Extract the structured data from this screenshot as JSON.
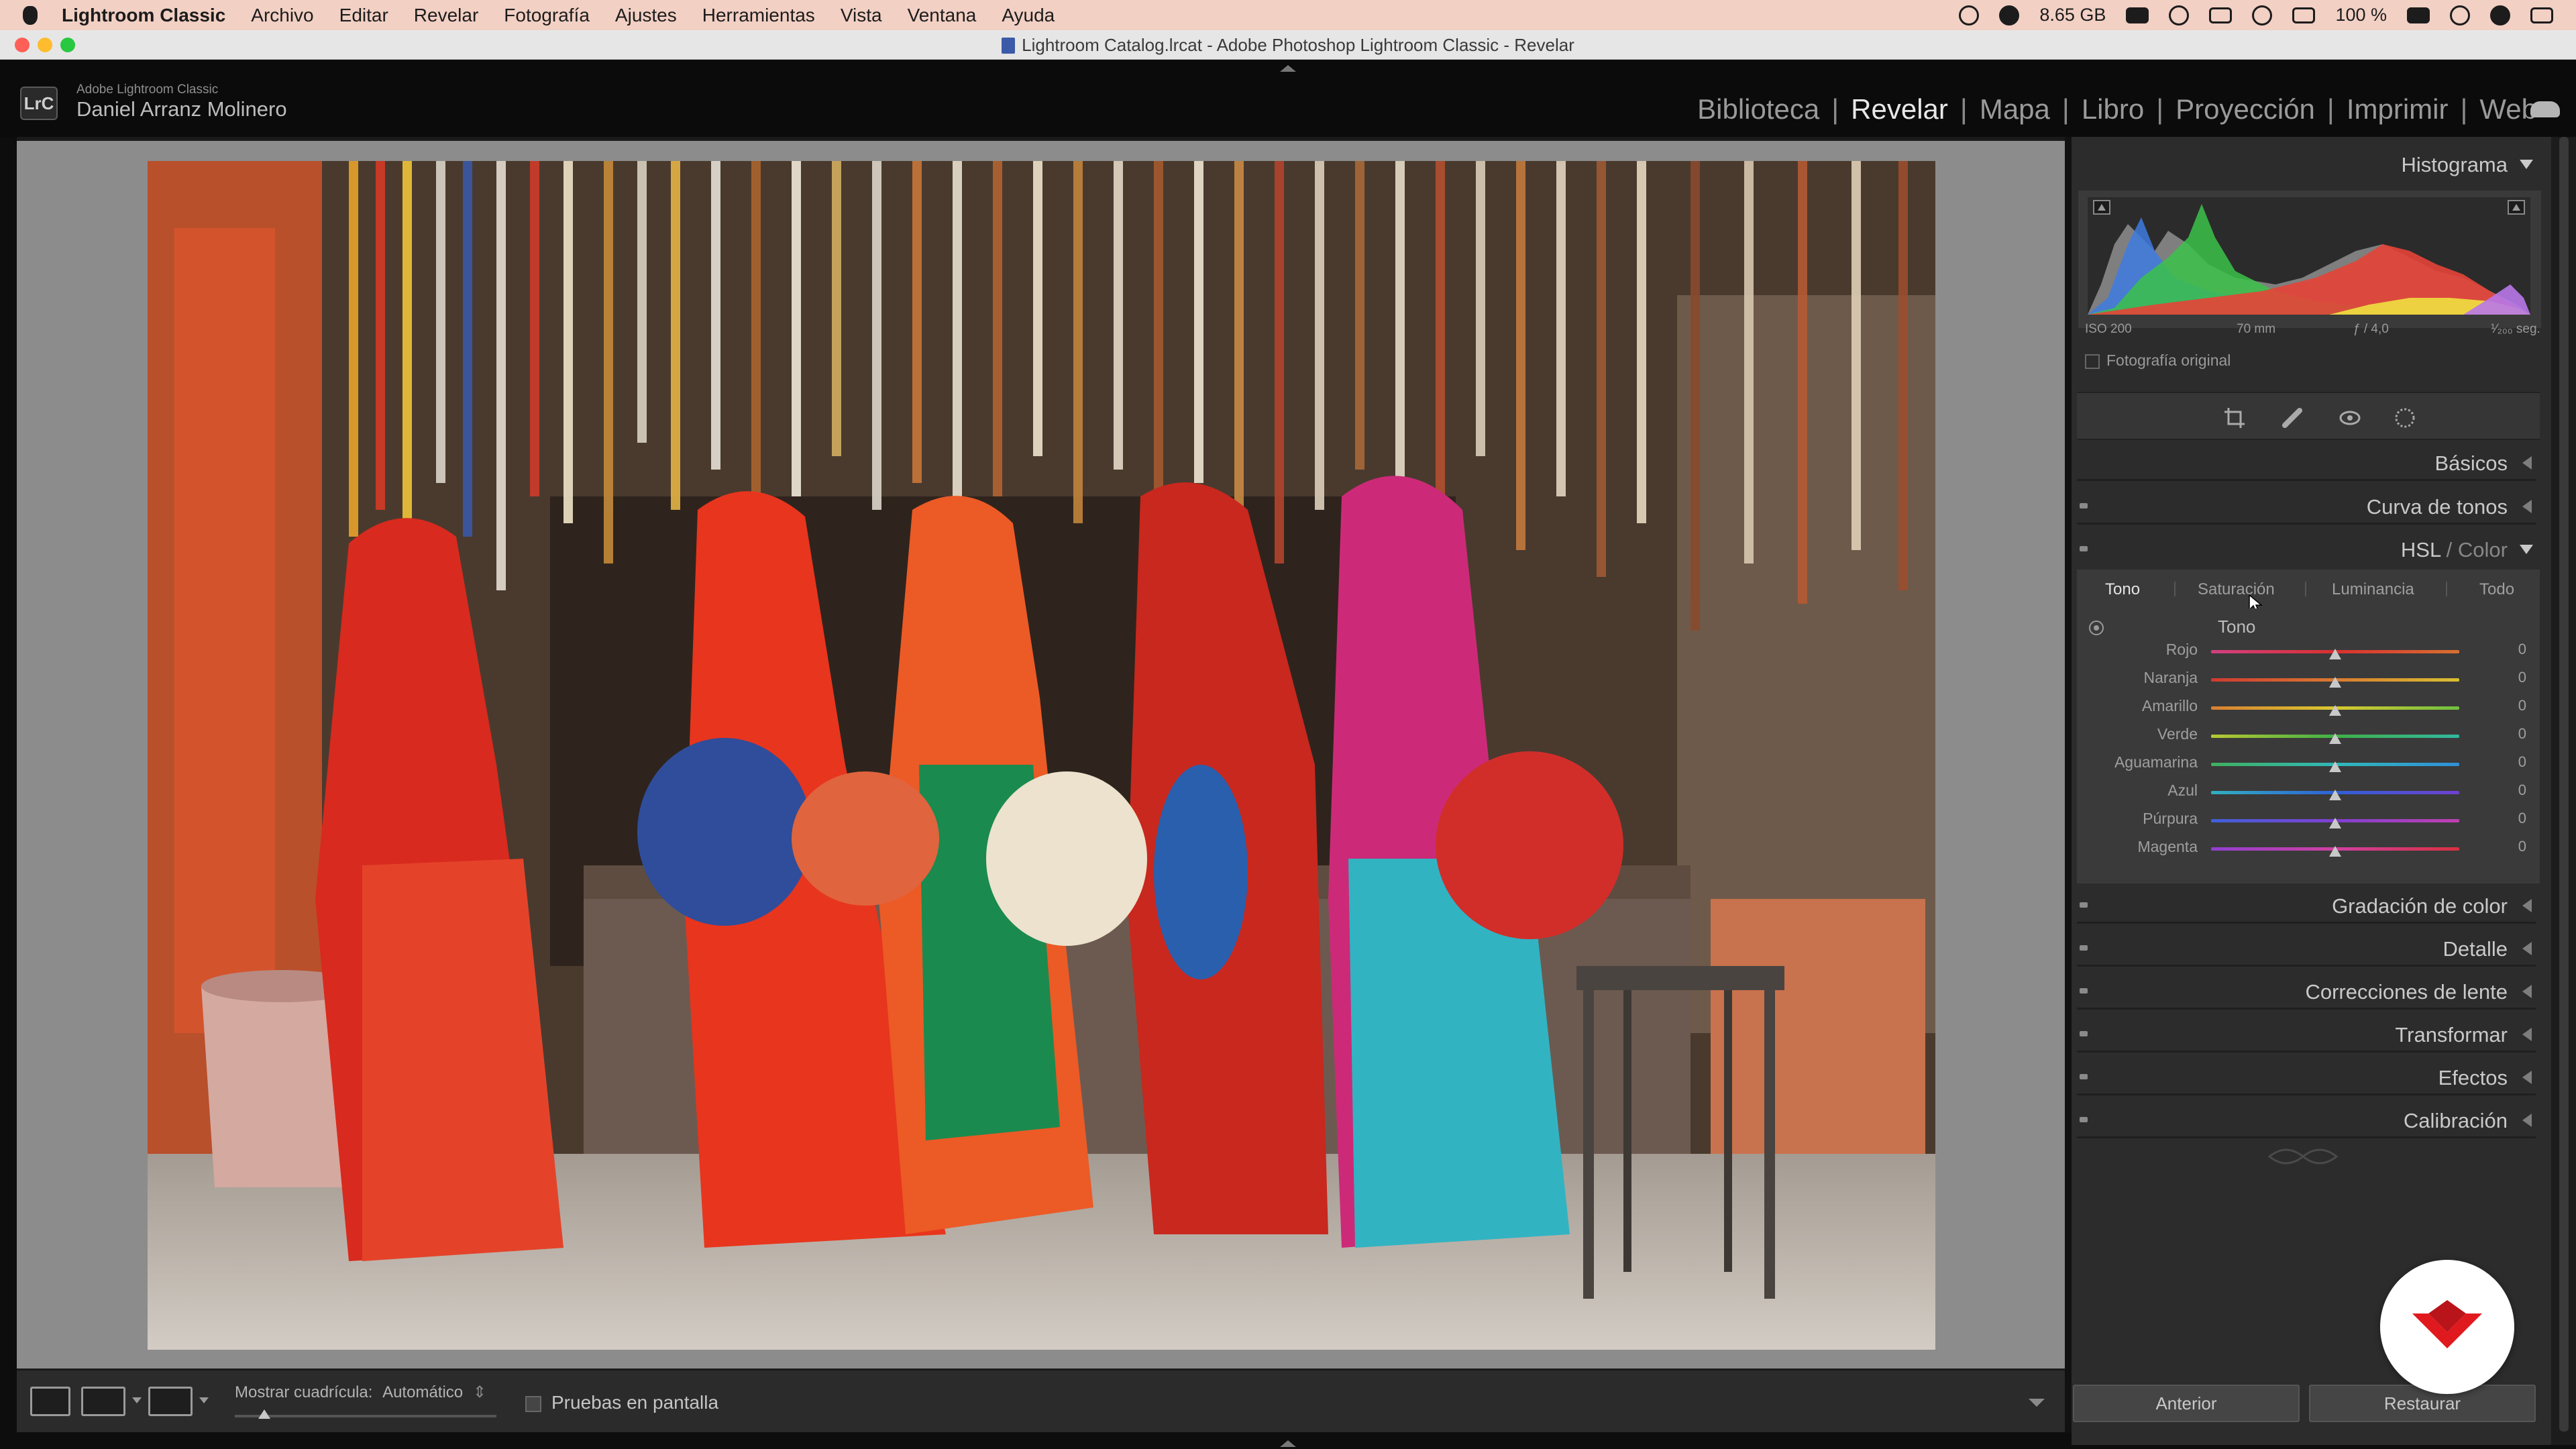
{
  "menubar": {
    "app_name": "Lightroom Classic",
    "items": [
      "Archivo",
      "Editar",
      "Revelar",
      "Fotografía",
      "Ajustes",
      "Herramientas",
      "Vista",
      "Ventana",
      "Ayuda"
    ],
    "memory": "8.65 GB",
    "battery": "100 %"
  },
  "window": {
    "title": "Lightroom Catalog.lrcat - Adobe Photoshop Lightroom Classic - Revelar"
  },
  "identity": {
    "logo_text": "LrC",
    "product": "Adobe Lightroom Classic",
    "user": "Daniel Arranz Molinero"
  },
  "modules": {
    "items": [
      "Biblioteca",
      "Revelar",
      "Mapa",
      "Libro",
      "Proyección",
      "Imprimir",
      "Web"
    ],
    "active": "Revelar"
  },
  "toolbar": {
    "grid_label": "Mostrar cuadrícula:",
    "grid_value": "Automático",
    "proof_label": "Pruebas en pantalla"
  },
  "histogram": {
    "title": "Histograma",
    "iso": "ISO 200",
    "focal": "70 mm",
    "aperture": "ƒ / 4,0",
    "shutter": "¹⁄₂₀₀ seg.",
    "original_label": "Fotografía original"
  },
  "panels": {
    "basic": "Básicos",
    "tone_curve": "Curva de tonos",
    "hsl_title": "HSL",
    "hsl_sep": "/",
    "color_title": "Color",
    "color_grading": "Gradación de color",
    "detail": "Detalle",
    "lens": "Correcciones de lente",
    "transform": "Transformar",
    "effects": "Efectos",
    "calibration": "Calibración"
  },
  "hsl": {
    "tabs": [
      "Tono",
      "Saturación",
      "Luminancia",
      "Todo"
    ],
    "active_tab": "Tono",
    "subtitle": "Tono",
    "sliders": [
      {
        "label": "Rojo",
        "value": "0"
      },
      {
        "label": "Naranja",
        "value": "0"
      },
      {
        "label": "Amarillo",
        "value": "0"
      },
      {
        "label": "Verde",
        "value": "0"
      },
      {
        "label": "Aguamarina",
        "value": "0"
      },
      {
        "label": "Azul",
        "value": "0"
      },
      {
        "label": "Púrpura",
        "value": "0"
      },
      {
        "label": "Magenta",
        "value": "0"
      }
    ]
  },
  "buttons": {
    "previous": "Anterior",
    "reset": "Restaurar"
  },
  "colors": {
    "menubar_bg": "#f2d0c4",
    "panel_bg": "#2c2c2c",
    "badge_red": "#e0191e"
  }
}
